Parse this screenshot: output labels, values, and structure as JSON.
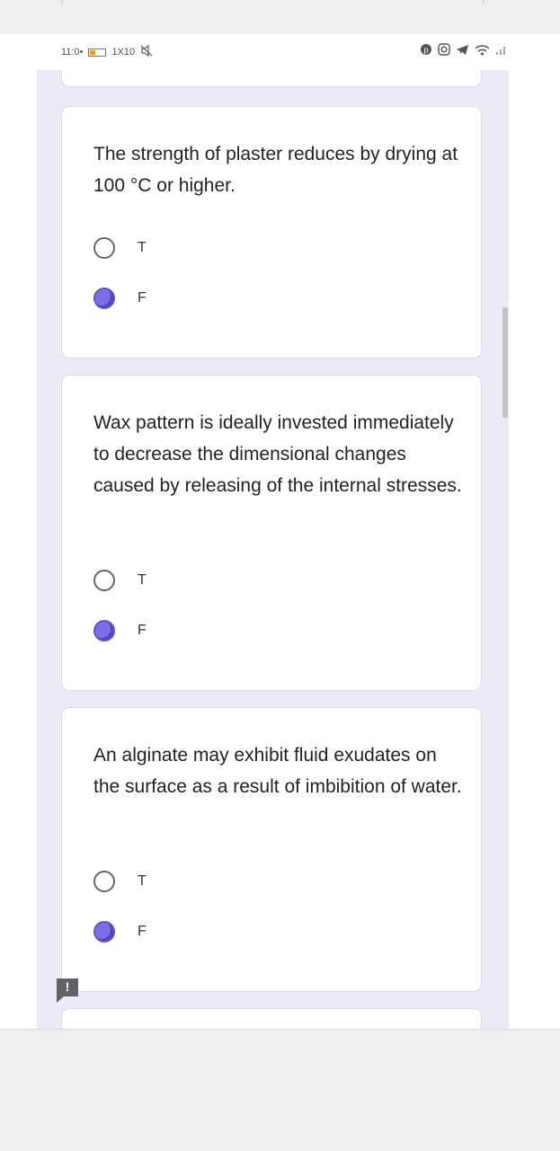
{
  "status_bar": {
    "time": "11:0•",
    "status_text": "1X10",
    "right_icons": [
      "pinterest-icon",
      "instagram-icon",
      "telegram-icon",
      "wifi-icon",
      "signal-icon"
    ]
  },
  "colors": {
    "accent": "#7f6ce8",
    "form_background": "#ebeaf6",
    "card_background": "#ffffff"
  },
  "questions": [
    {
      "text": "The strength of plaster reduces by drying at 100 °C or higher.",
      "options": [
        {
          "label": "T",
          "selected": false
        },
        {
          "label": "F",
          "selected": true
        }
      ]
    },
    {
      "text": "Wax pattern is ideally invested immediately to decrease the dimensional changes caused by releasing of the internal stresses.",
      "options": [
        {
          "label": "T",
          "selected": false
        },
        {
          "label": "F",
          "selected": true
        }
      ]
    },
    {
      "text": "An alginate may exhibit fluid exudates on the surface as a result of imbibition of water.",
      "options": [
        {
          "label": "T",
          "selected": false
        },
        {
          "label": "F",
          "selected": true
        }
      ]
    }
  ],
  "feedback": {
    "icon": "feedback-icon",
    "glyph": "!"
  }
}
